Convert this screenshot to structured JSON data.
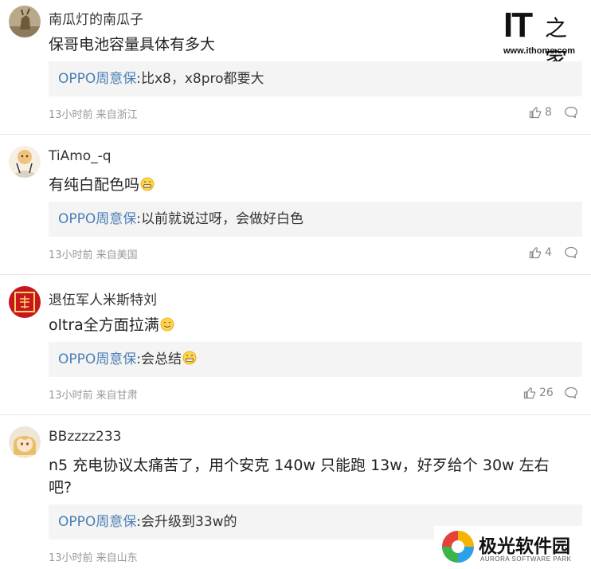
{
  "header_logo": {
    "mark": "IT",
    "chinese": "之家",
    "url": "www.ithome.com"
  },
  "comments": [
    {
      "username": "南瓜灯的南瓜子",
      "content": "保哥电池容量具体有多大",
      "content_emoji": "",
      "reply": {
        "name": "OPPO周意保",
        "sep": ":",
        "text": "比x8，x8pro都要大",
        "emoji": ""
      },
      "meta": "13小时前 来自浙江",
      "likes": "8",
      "avatar_icon": "deer-avatar"
    },
    {
      "username": "TiAmo_-q",
      "content": "有纯白配色吗",
      "content_emoji": "grin-emoji",
      "reply": {
        "name": "OPPO周意保",
        "sep": ":",
        "text": "以前就说过呀，会做好白色",
        "emoji": ""
      },
      "meta": "13小时前 来自美国",
      "likes": "4",
      "avatar_icon": "cartoon-avatar"
    },
    {
      "username": "退伍军人米斯特刘",
      "content": "oltra全方面拉满",
      "content_emoji": "smile-emoji",
      "reply": {
        "name": "OPPO周意保",
        "sep": ":",
        "text": "会总结",
        "emoji": "grin-emoji"
      },
      "meta": "13小时前 来自甘肃",
      "likes": "26",
      "avatar_icon": "red-seal-avatar"
    },
    {
      "username": "BBzzzz233",
      "content": "n5 充电协议太痛苦了，用个安克 140w 只能跑 13w，好歹给个 30w 左右吧?",
      "content_emoji": "",
      "reply": {
        "name": "OPPO周意保",
        "sep": ":",
        "text": "会升级到33w的",
        "emoji": ""
      },
      "meta": "13小时前 来自山东",
      "likes": "",
      "avatar_icon": "anime-girl-avatar"
    }
  ],
  "watermark": {
    "chinese": "极光软件园",
    "english": "AURORA SOFTWARE PARK"
  },
  "colors": {
    "reply_name": "#4a7fb5",
    "reply_bg": "#f4f4f4",
    "meta": "#999999"
  }
}
